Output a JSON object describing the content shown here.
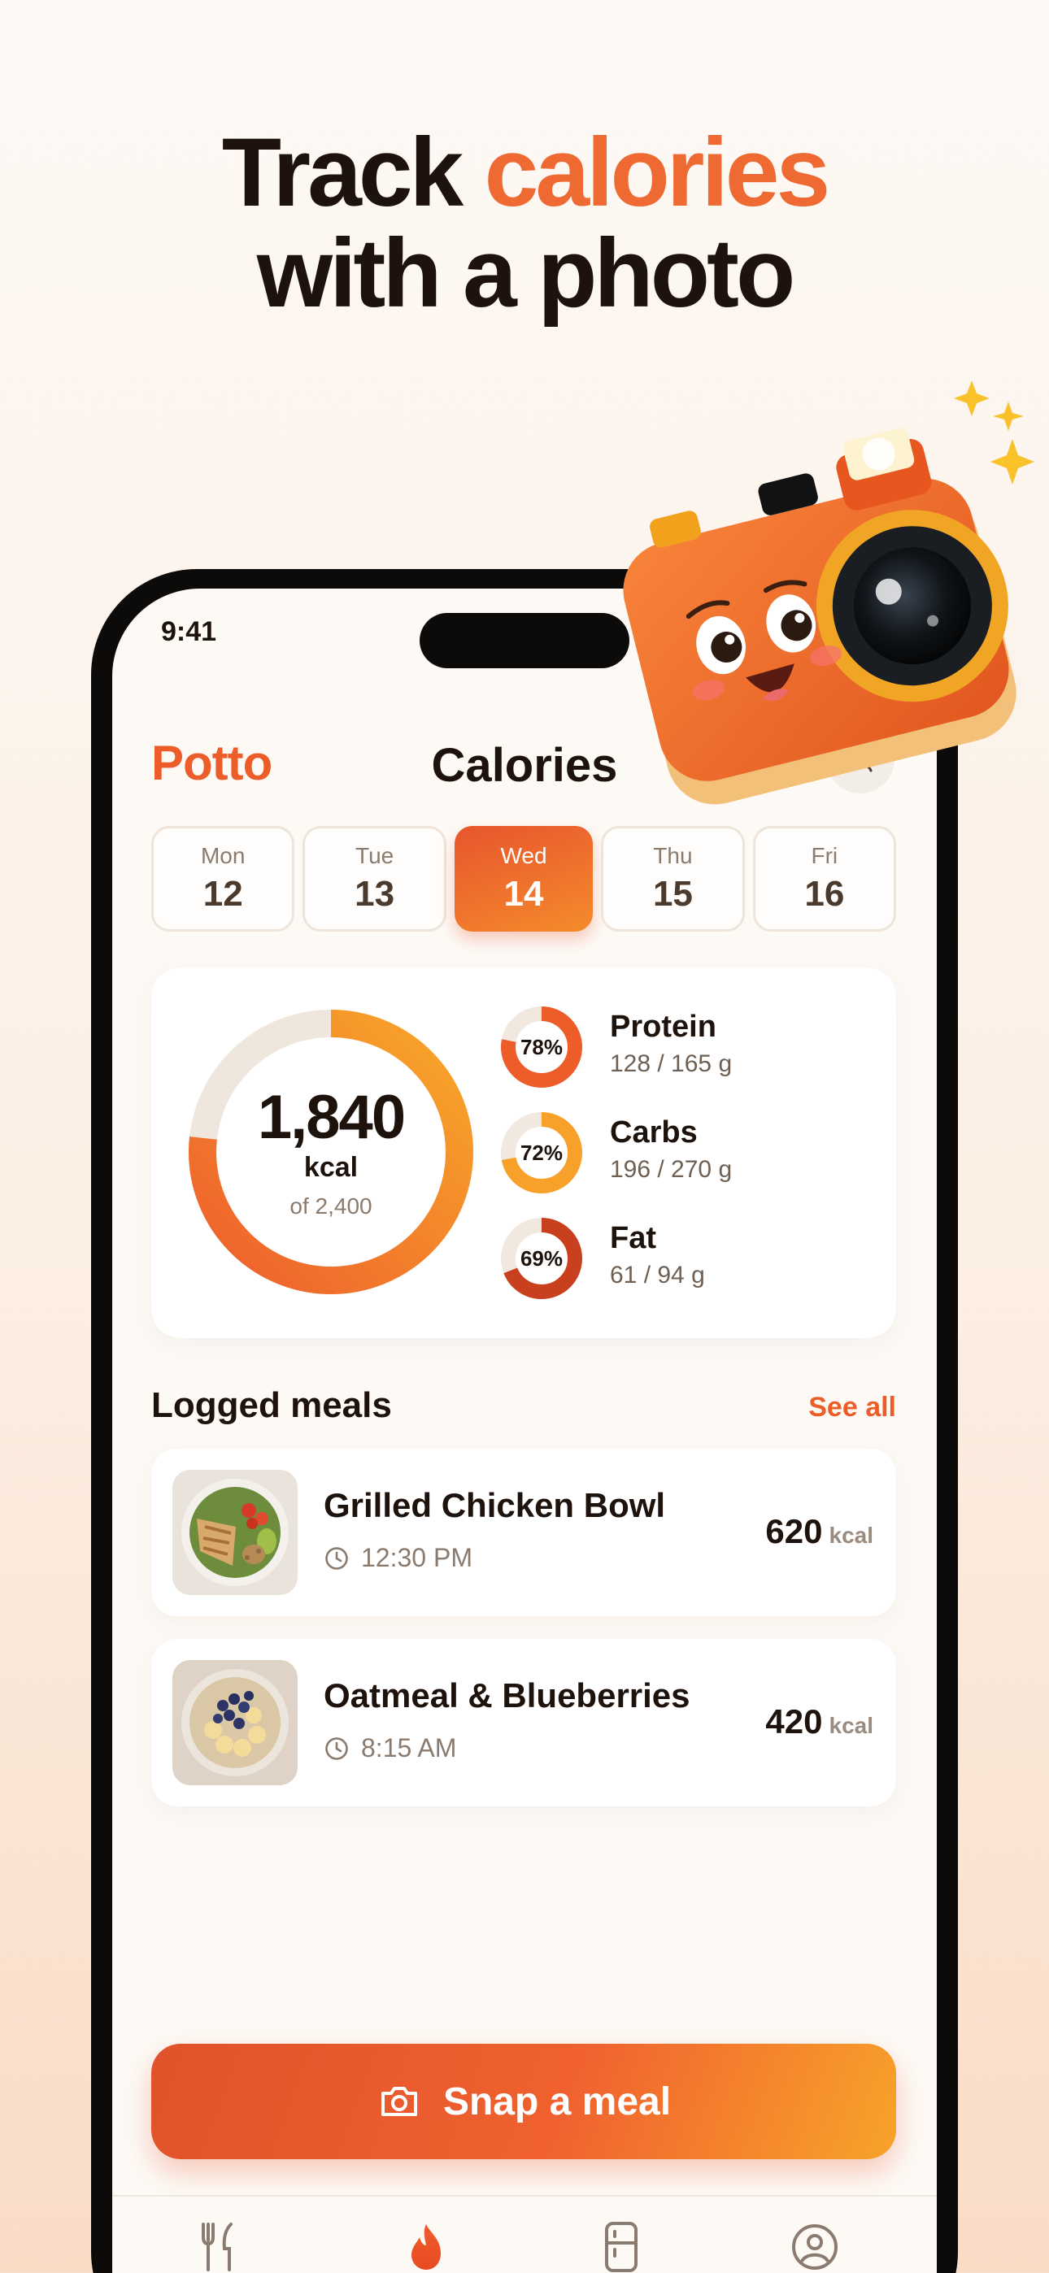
{
  "headline": {
    "line1_plain": "Track ",
    "line1_accent": "calories",
    "line2": "with a photo"
  },
  "status_bar": {
    "time": "9:41"
  },
  "header": {
    "brand": "Potto",
    "title": "Calories"
  },
  "days": [
    {
      "name": "Mon",
      "date": "12",
      "selected": false
    },
    {
      "name": "Tue",
      "date": "13",
      "selected": false
    },
    {
      "name": "Wed",
      "date": "14",
      "selected": true
    },
    {
      "name": "Thu",
      "date": "15",
      "selected": false
    },
    {
      "name": "Fri",
      "date": "16",
      "selected": false
    }
  ],
  "summary": {
    "calories_value": "1,840",
    "calories_unit": "kcal",
    "calories_goal": "of 2,400",
    "calories_fraction": 0.767,
    "macros": [
      {
        "name": "Protein",
        "percent_label": "78%",
        "fraction": 0.78,
        "amount": "128 / 165 g",
        "color": "#ec5d2a"
      },
      {
        "name": "Carbs",
        "percent_label": "72%",
        "fraction": 0.72,
        "amount": "196 / 270 g",
        "color": "#f7a12a"
      },
      {
        "name": "Fat",
        "percent_label": "69%",
        "fraction": 0.69,
        "amount": "61 / 94 g",
        "color": "#c9401f"
      }
    ]
  },
  "meals_section": {
    "title": "Logged meals",
    "see_all": "See all"
  },
  "meals": [
    {
      "name": "Grilled Chicken Bowl",
      "time": "12:30 PM",
      "kcal": "620",
      "unit": "kcal"
    },
    {
      "name": "Oatmeal & Blueberries",
      "time": "8:15 AM",
      "kcal": "420",
      "unit": "kcal"
    }
  ],
  "snap_button": {
    "label": "Snap a meal"
  },
  "tabs": [
    {
      "icon": "fork-knife-icon",
      "active": false
    },
    {
      "icon": "flame-icon",
      "active": true
    },
    {
      "icon": "fridge-icon",
      "active": false
    },
    {
      "icon": "profile-icon",
      "active": false
    }
  ],
  "colors": {
    "accent": "#ec5d2a",
    "accent_light": "#f7a12a",
    "text": "#1e130c",
    "muted": "#8a7b6e"
  }
}
